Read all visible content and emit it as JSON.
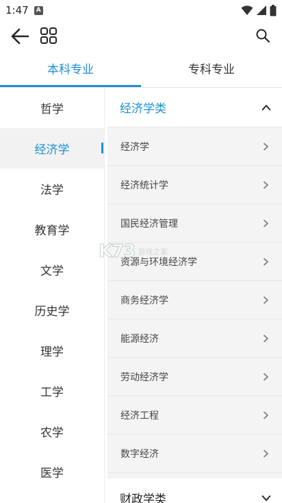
{
  "status": {
    "time": "1:47",
    "notification_letter": "A"
  },
  "tabs": [
    {
      "label": "本科专业",
      "active": true
    },
    {
      "label": "专科专业",
      "active": false
    }
  ],
  "sidebar": {
    "items": [
      {
        "label": "哲学"
      },
      {
        "label": "经济学",
        "active": true
      },
      {
        "label": "法学"
      },
      {
        "label": "教育学"
      },
      {
        "label": "文学"
      },
      {
        "label": "历史学"
      },
      {
        "label": "理学"
      },
      {
        "label": "工学"
      },
      {
        "label": "农学"
      },
      {
        "label": "医学"
      }
    ]
  },
  "content": {
    "open_group": {
      "title": "经济学类",
      "items": [
        "经济学",
        "经济统计学",
        "国民经济管理",
        "资源与环境经济学",
        "商务经济学",
        "能源经济",
        "劳动经济学",
        "经济工程",
        "数字经济"
      ]
    },
    "closed_group": {
      "title": "财政学类"
    }
  },
  "watermark": {
    "logo": "K73",
    "text": "游戏之家"
  },
  "colors": {
    "accent": "#1a8fd8"
  }
}
